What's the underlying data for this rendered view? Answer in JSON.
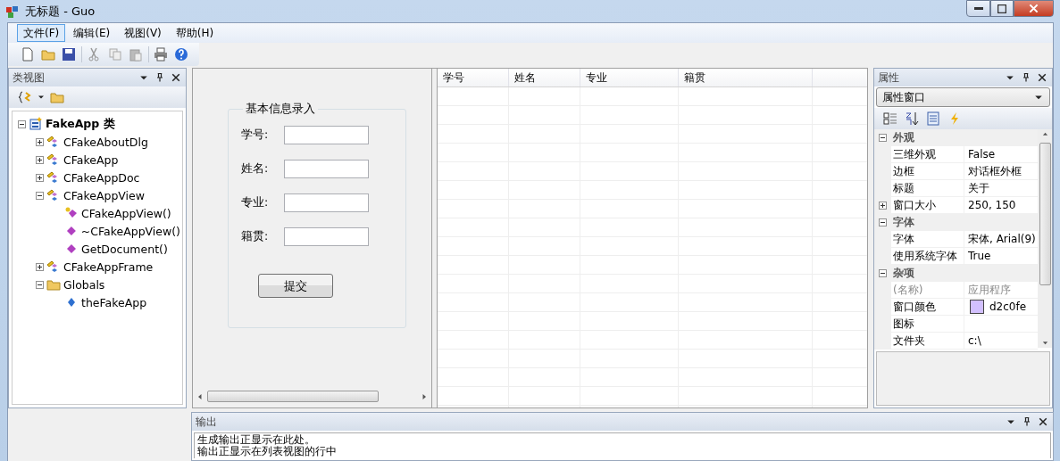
{
  "window": {
    "title": "无标题 - Guo"
  },
  "menu": [
    {
      "label": "文件(F)",
      "selected": true
    },
    {
      "label": "编辑(E)",
      "selected": false
    },
    {
      "label": "视图(V)",
      "selected": false
    },
    {
      "label": "帮助(H)",
      "selected": false
    }
  ],
  "class_view": {
    "title": "类视图",
    "tree": [
      {
        "label": "FakeApp 类",
        "kind": "project",
        "expanded": true,
        "children": [
          {
            "label": "CFakeAboutDlg",
            "kind": "class",
            "expanded": false
          },
          {
            "label": "CFakeApp",
            "kind": "class",
            "expanded": false
          },
          {
            "label": "CFakeAppDoc",
            "kind": "class",
            "expanded": false
          },
          {
            "label": "CFakeAppView",
            "kind": "class",
            "expanded": true,
            "children": [
              {
                "label": "CFakeAppView()",
                "kind": "method-protected"
              },
              {
                "label": "~CFakeAppView()",
                "kind": "method"
              },
              {
                "label": "GetDocument()",
                "kind": "method"
              }
            ]
          },
          {
            "label": "CFakeAppFrame",
            "kind": "class",
            "expanded": false
          },
          {
            "label": "Globals",
            "kind": "folder",
            "expanded": true,
            "children": [
              {
                "label": "theFakeApp",
                "kind": "variable"
              }
            ]
          }
        ]
      }
    ]
  },
  "form": {
    "group_title": "基本信息录入",
    "fields": [
      {
        "label": "学号:"
      },
      {
        "label": "姓名:"
      },
      {
        "label": "专业:"
      },
      {
        "label": "籍贯:"
      }
    ],
    "submit": "提交"
  },
  "table": {
    "columns": [
      "学号",
      "姓名",
      "专业",
      "籍贯"
    ]
  },
  "properties": {
    "title": "属性",
    "selector": "属性窗口",
    "rows": [
      {
        "kind": "category",
        "name": "外观",
        "expanded": true
      },
      {
        "kind": "property",
        "name": "三维外观",
        "value": "False"
      },
      {
        "kind": "property",
        "name": "边框",
        "value": "对话框外框"
      },
      {
        "kind": "property",
        "name": "标题",
        "value": "关于"
      },
      {
        "kind": "property",
        "name": "窗口大小",
        "value": "250, 150",
        "expanded": false
      },
      {
        "kind": "category",
        "name": "字体",
        "expanded": true
      },
      {
        "kind": "property",
        "name": "字体",
        "value": "宋体, Arial(9)"
      },
      {
        "kind": "property",
        "name": "使用系统字体",
        "value": "True"
      },
      {
        "kind": "category",
        "name": "杂项",
        "expanded": true
      },
      {
        "kind": "property",
        "name": "(名称)",
        "value": "应用程序",
        "disabled": true
      },
      {
        "kind": "color",
        "name": "窗口颜色",
        "value": "d2c0fe",
        "color": "#d2c0fe"
      },
      {
        "kind": "property",
        "name": "图标"
      },
      {
        "kind": "property",
        "name": "文件夹",
        "value": "c:\\"
      }
    ]
  },
  "output": {
    "title": "输出",
    "lines": [
      "生成输出正显示在此处。",
      "输出正显示在列表视图的行中"
    ]
  }
}
